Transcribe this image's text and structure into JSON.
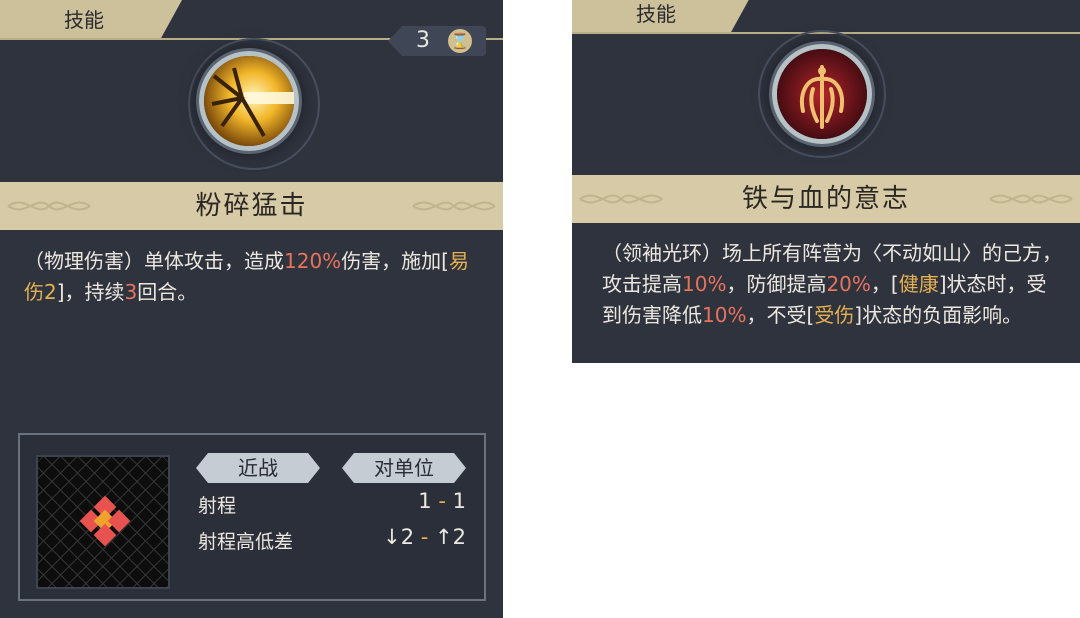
{
  "left": {
    "tab": "技能",
    "cooldown": "3",
    "skill_name": "粉碎猛击",
    "description": {
      "p1": "（物理伤害）单体攻击，造成",
      "damage": "120%",
      "p2": "伤害，施加[",
      "status": "易伤2",
      "p3": "]，持续",
      "turns": "3",
      "p4": "回合。"
    },
    "range": {
      "type": "近战",
      "target": "对单位",
      "range_label": "射程",
      "range_min": "1",
      "range_sep": "-",
      "range_max": "1",
      "height_label": "射程高低差",
      "height_down": "↓2",
      "height_sep": "-",
      "height_up": "↑2"
    }
  },
  "right": {
    "tab": "技能",
    "skill_name": "铁与血的意志",
    "description": {
      "p1": "（领袖光环）场上所有阵营为〈不动如山〉的己方，攻击提高",
      "atk": "10%",
      "p2": "，防御提高",
      "def": "20%",
      "p3": "，[",
      "status1": "健康",
      "p4": "]状态时，受到伤害降低",
      "dmg": "10%",
      "p5": "，不受[",
      "status2": "受伤",
      "p6": "]状态的负面影响。"
    }
  },
  "colors": {
    "panel": "#2f333e",
    "banner": "#d7cba7",
    "highlight_red": "#e7735d",
    "highlight_gold": "#e4b052",
    "range_tile_red": "#e9534f",
    "range_tile_center": "#f0a22d"
  },
  "icons": {
    "left_skill": "shatter-strike-icon",
    "right_skill": "iron-blood-emblem-icon",
    "cooldown": "hourglass-icon"
  }
}
